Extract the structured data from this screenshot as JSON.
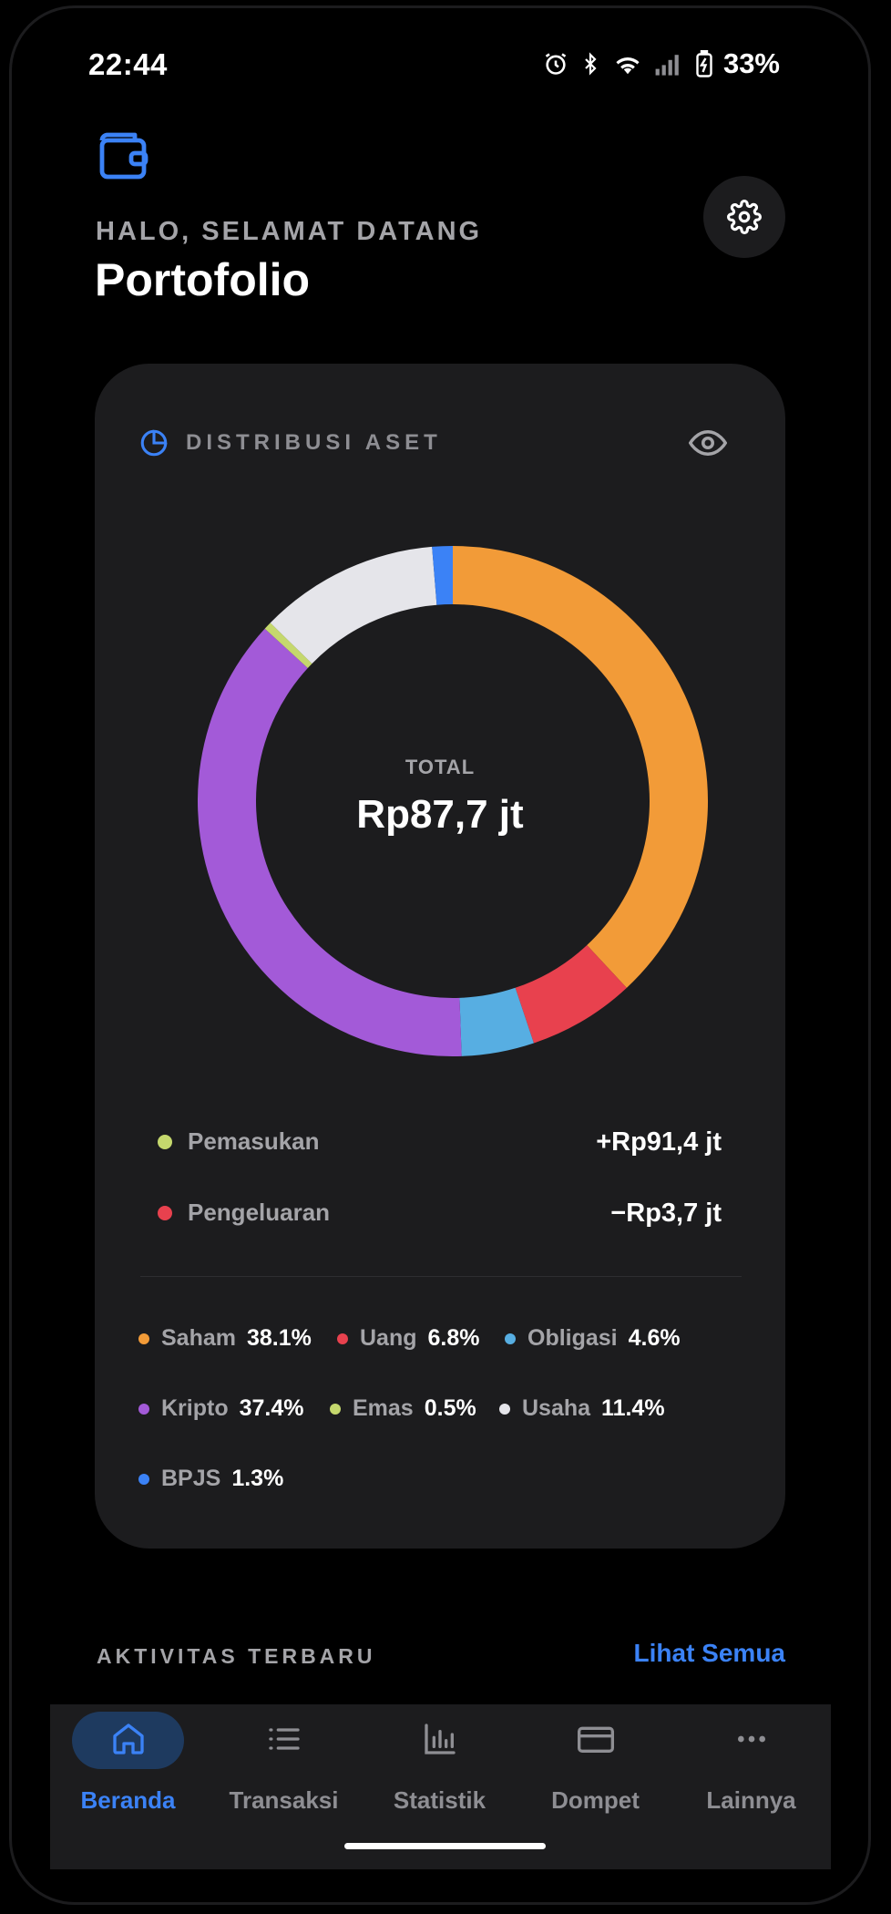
{
  "status_bar": {
    "time": "22:44",
    "battery": "33%"
  },
  "header": {
    "greeting": "HALO, SELAMAT DATANG",
    "title": "Portofolio"
  },
  "card": {
    "title": "DISTRIBUSI ASET",
    "total_label": "TOTAL",
    "total_value": "Rp87,7 jt",
    "income": {
      "label": "Pemasukan",
      "value": "+Rp91,4 jt",
      "color": "#c5d86d"
    },
    "expense": {
      "label": "Pengeluaran",
      "value": "−Rp3,7 jt",
      "color": "#e8414e"
    }
  },
  "assets": [
    {
      "name": "Saham",
      "pct_label": "38.1%",
      "pct": 38.1,
      "color": "#f29b38"
    },
    {
      "name": "Uang",
      "pct_label": "6.8%",
      "pct": 6.8,
      "color": "#e8414e"
    },
    {
      "name": "Obligasi",
      "pct_label": "4.6%",
      "pct": 4.6,
      "color": "#57aee2"
    },
    {
      "name": "Kripto",
      "pct_label": "37.4%",
      "pct": 37.4,
      "color": "#a35ad8"
    },
    {
      "name": "Emas",
      "pct_label": "0.5%",
      "pct": 0.5,
      "color": "#c5d86d"
    },
    {
      "name": "Usaha",
      "pct_label": "11.4%",
      "pct": 11.4,
      "color": "#e5e5ea"
    },
    {
      "name": "BPJS",
      "pct_label": "1.3%",
      "pct": 1.3,
      "color": "#3b82f6"
    }
  ],
  "activity": {
    "title": "AKTIVITAS TERBARU",
    "see_all": "Lihat Semua"
  },
  "nav": [
    {
      "label": "Beranda",
      "icon": "home-icon",
      "active": true
    },
    {
      "label": "Transaksi",
      "icon": "list-icon",
      "active": false
    },
    {
      "label": "Statistik",
      "icon": "chart-icon",
      "active": false
    },
    {
      "label": "Dompet",
      "icon": "card-icon",
      "active": false
    },
    {
      "label": "Lainnya",
      "icon": "more-icon",
      "active": false
    }
  ],
  "colors": {
    "accent": "#3b82f6",
    "card_bg": "#1c1c1e",
    "background": "#000000"
  }
}
